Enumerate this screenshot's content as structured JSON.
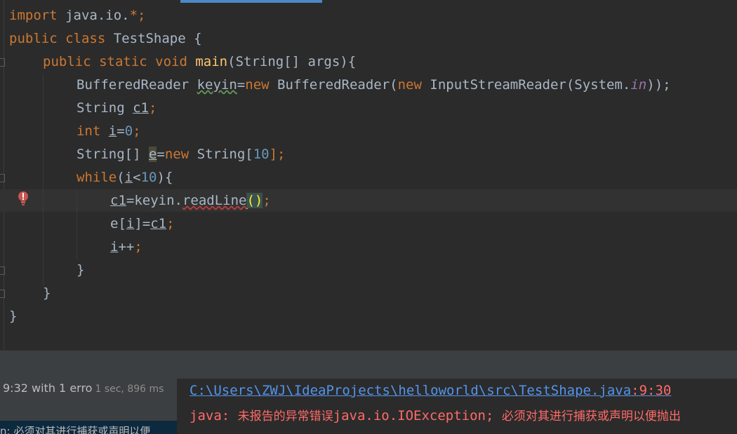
{
  "code": {
    "l1_import": "import",
    "l1_pkg": " java.io.",
    "l1_star": "*",
    "l1_semi": ";",
    "l2_public": "public",
    "l2_class": " class",
    "l2_name": " TestShape {",
    "l3_mods": "public static void",
    "l3_main": "main",
    "l3_rest": "(String[] args){",
    "l4_type": "BufferedReader ",
    "l4_var": "keyin",
    "l4_eq": "=",
    "l4_new1": "new",
    "l4_br": " BufferedReader(",
    "l4_new2": "new",
    "l4_isr": " InputStreamReader(System.",
    "l4_in": "in",
    "l4_end": "));",
    "l5_type": "String ",
    "l5_var": "c1",
    "l5_semi": ";",
    "l6_int": "int",
    "l6_var": "i",
    "l6_eq": "=",
    "l6_zero": "0",
    "l6_semi": ";",
    "l7_type": "String[] ",
    "l7_var": "e",
    "l7_eq": "=",
    "l7_new": "new",
    "l7_str": " String[",
    "l7_ten": "10",
    "l7_end": "];",
    "l8_while": "while",
    "l8_open": "(",
    "l8_var": "i",
    "l8_lt": "<",
    "l8_ten": "10",
    "l8_end": "){",
    "l9_var": "c1",
    "l9_eq": "=keyin.",
    "l9_method": "readLine",
    "l9_parens": "()",
    "l9_semi": ";",
    "l10_e": "e[",
    "l10_i": "i",
    "l10_mid": "]=",
    "l10_c1": "c1",
    "l10_semi": ";",
    "l11_i": "i",
    "l11_pp": "++",
    "l11_semi": ";",
    "l12_brace": "}",
    "l13_brace": "}",
    "l14_brace": "}"
  },
  "build": {
    "status": "9:32 with 1 erro",
    "time": "1 sec, 896 ms",
    "left_message": "n: 必须对其进行捕获或声明以便"
  },
  "output": {
    "path": "C:\\Users\\ZWJ\\IdeaProjects\\helloworld\\src\\TestShape.java",
    "position": ":9:30",
    "err_prefix": "java: ",
    "err_cn1": "未报告的异常错误",
    "err_exception": "java.io.IOException",
    "err_semi": "; ",
    "err_cn2": "必须对其进行捕获或声明以便抛出"
  },
  "colors": {
    "keyword": "#cc7832",
    "method": "#ffc66d",
    "number": "#6897bb",
    "field": "#9876aa",
    "error": "#ff6b68",
    "link": "#5394ec"
  }
}
